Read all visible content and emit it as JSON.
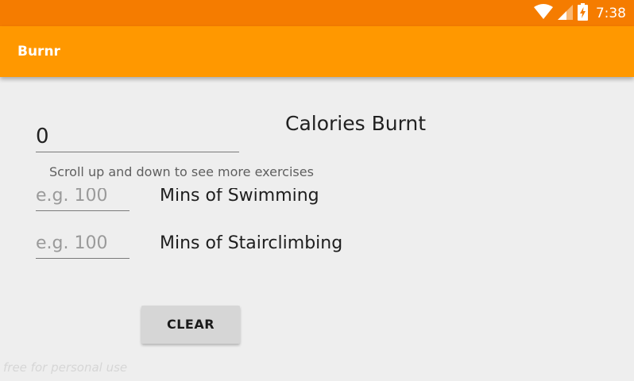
{
  "status_bar": {
    "time": "7:38",
    "icons": [
      "wifi-icon",
      "cell-signal-icon",
      "battery-charging-icon"
    ]
  },
  "app_bar": {
    "title": "Burnr"
  },
  "calories": {
    "value": "0",
    "label": "Calories Burnt"
  },
  "hint": "Scroll up and down to see more exercises",
  "exercises": [
    {
      "placeholder": "e.g. 100",
      "label": "Mins of Swimming"
    },
    {
      "placeholder": "e.g. 100",
      "label": "Mins of Stairclimbing"
    }
  ],
  "clear_button_label": "CLEAR",
  "watermark": "free for personal use",
  "colors": {
    "status_bar": "#f57c00",
    "app_bar": "#ff9800",
    "background": "#eeeeee"
  }
}
